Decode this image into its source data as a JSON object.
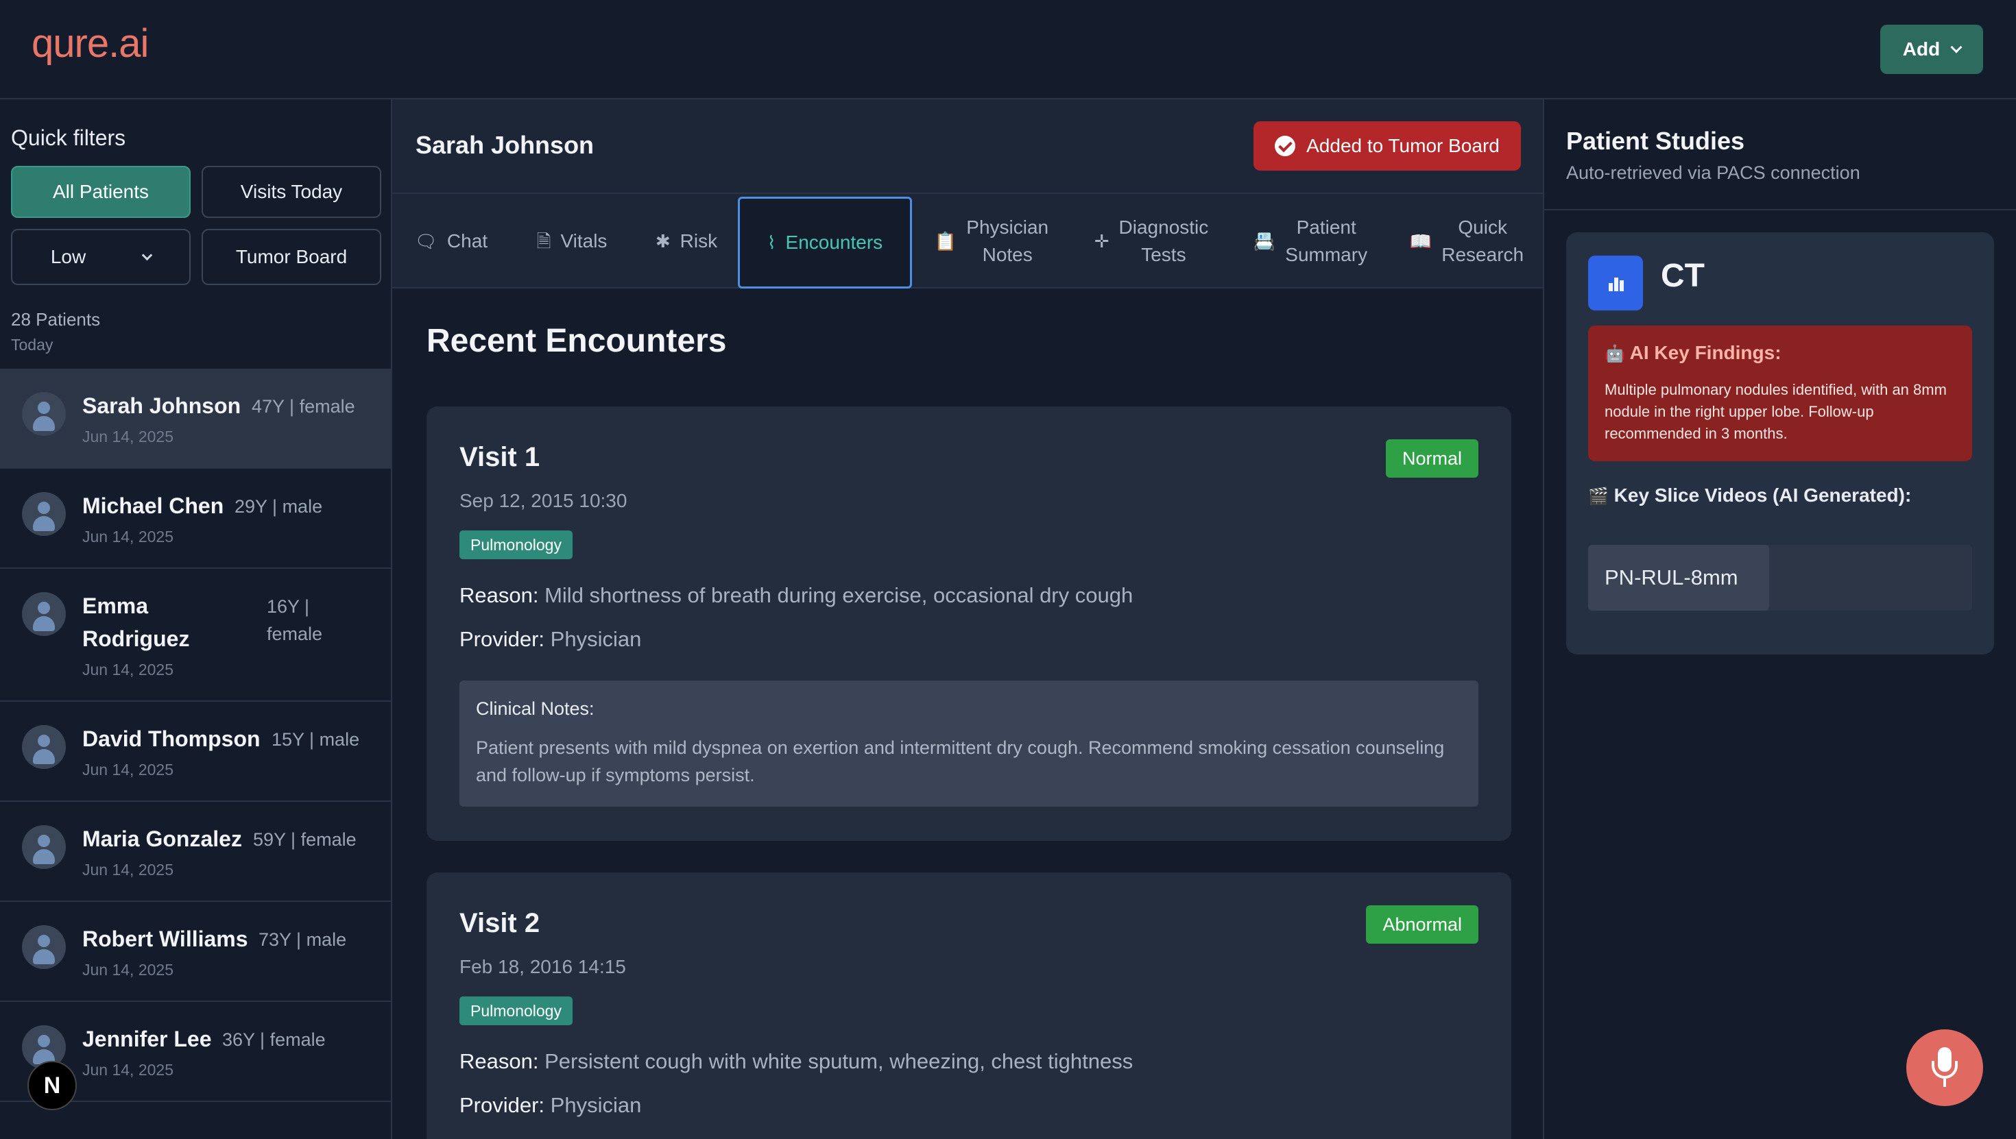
{
  "app": {
    "logo": "qure.ai",
    "add_label": "Add"
  },
  "sidebar": {
    "title": "Quick filters",
    "filters": [
      "All Patients",
      "Visits Today",
      "Low",
      "Tumor Board"
    ],
    "count": "28 Patients",
    "count_sub": "Today",
    "patients": [
      {
        "name": "Sarah Johnson",
        "meta": "47Y | female",
        "date": "Jun 14, 2025"
      },
      {
        "name": "Michael Chen",
        "meta": "29Y | male",
        "date": "Jun 14, 2025"
      },
      {
        "name": "Emma Rodriguez",
        "name1": "Emma",
        "name2": "Rodriguez",
        "meta": "16Y | female",
        "meta1": "16Y |",
        "meta2": "female",
        "date": "Jun 14, 2025"
      },
      {
        "name": "David Thompson",
        "meta": "15Y | male",
        "date": "Jun 14, 2025"
      },
      {
        "name": "Maria Gonzalez",
        "meta": "59Y | female",
        "date": "Jun 14, 2025"
      },
      {
        "name": "Robert Williams",
        "meta": "73Y | male",
        "date": "Jun 14, 2025"
      },
      {
        "name": "Jennifer Lee",
        "meta": "36Y | female",
        "date": "Jun 14, 2025"
      }
    ]
  },
  "main": {
    "patient_name": "Sarah Johnson",
    "tumor_board_label": "Added to Tumor Board",
    "tabs": [
      {
        "label": "Chat",
        "icon": "chat-bubbles-icon"
      },
      {
        "label": "Vitals",
        "icon": "document-icon"
      },
      {
        "label": "Risk",
        "icon": "asterisk-icon"
      },
      {
        "label": "Encounters",
        "icon": "pulse-icon"
      },
      {
        "label1": "Physician",
        "label2": "Notes",
        "icon": "clipboard-icon"
      },
      {
        "label1": "Diagnostic",
        "label2": "Tests",
        "icon": "puzzle-icon"
      },
      {
        "label1": "Patient",
        "label2": "Summary",
        "icon": "id-card-icon"
      },
      {
        "label1": "Quick",
        "label2": "Research",
        "icon": "book-icon"
      }
    ],
    "section_title": "Recent Encounters",
    "visits": [
      {
        "title": "Visit 1",
        "status": "Normal",
        "date": "Sep 12, 2015 10:30",
        "department": "Pulmonology",
        "reason_label": "Reason:",
        "reason": "Mild shortness of breath during exercise, occasional dry cough",
        "provider_label": "Provider:",
        "provider": "Physician",
        "notes_label": "Clinical Notes:",
        "notes": "Patient presents with mild dyspnea on exertion and intermittent dry cough. Recommend smoking cessation counseling and follow-up if symptoms persist."
      },
      {
        "title": "Visit 2",
        "status": "Abnormal",
        "date": "Feb 18, 2016 14:15",
        "department": "Pulmonology",
        "reason_label": "Reason:",
        "reason": "Persistent cough with white sputum, wheezing, chest tightness",
        "provider_label": "Provider:",
        "provider": "Physician"
      }
    ]
  },
  "studies": {
    "title": "Patient Studies",
    "subtitle": "Auto-retrieved via PACS connection",
    "modality": "CT",
    "findings_title": "AI Key Findings:",
    "findings_text": "Multiple pulmonary nodules identified, with an 8mm nodule in the right upper lobe. Follow-up recommended in 3 months.",
    "slice_title": "Key Slice Videos (AI Generated):",
    "slices": [
      "PN-RUL-8mm"
    ]
  },
  "colors": {
    "background": "#141c2b",
    "accent_teal": "#2e7d6f",
    "alert_red": "#b3262a",
    "status_green": "#2ea046",
    "logo": "#e8776a"
  }
}
